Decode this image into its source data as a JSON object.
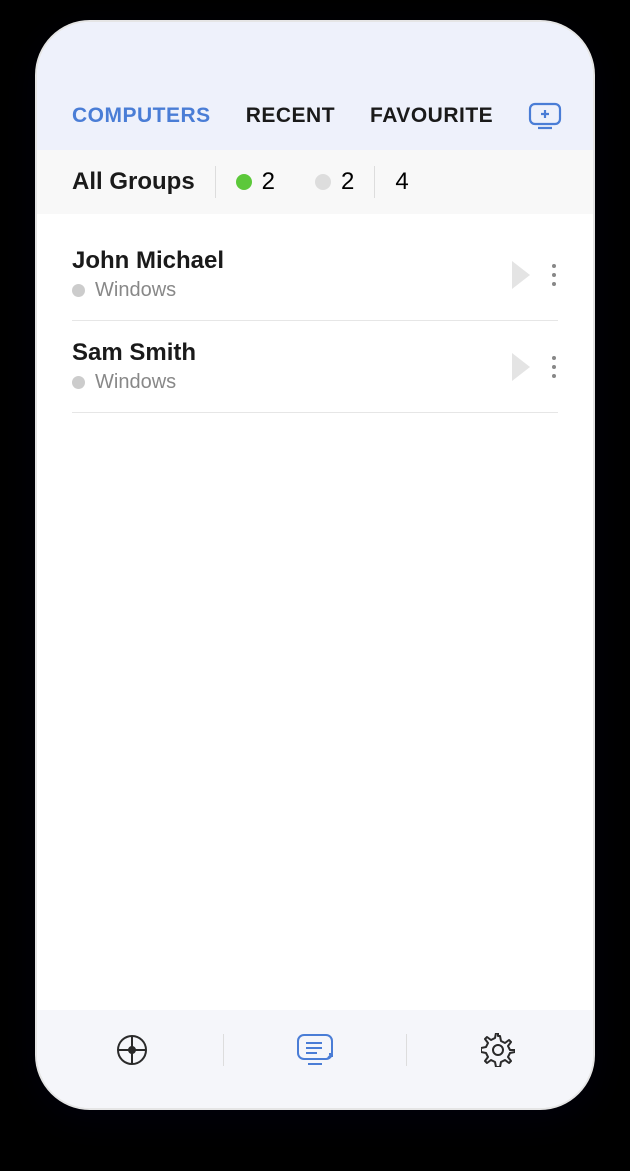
{
  "tabs": {
    "computers": "COMPUTERS",
    "recent": "RECENT",
    "favourite": "FAVOURITE"
  },
  "summary": {
    "label": "All Groups",
    "online": "2",
    "offline": "2",
    "total": "4"
  },
  "computers": [
    {
      "name": "John Michael",
      "os": "Windows"
    },
    {
      "name": "Sam Smith",
      "os": "Windows"
    }
  ],
  "colors": {
    "accent": "#4a7dd6",
    "online": "#5cc83a",
    "offline": "#ddd"
  }
}
